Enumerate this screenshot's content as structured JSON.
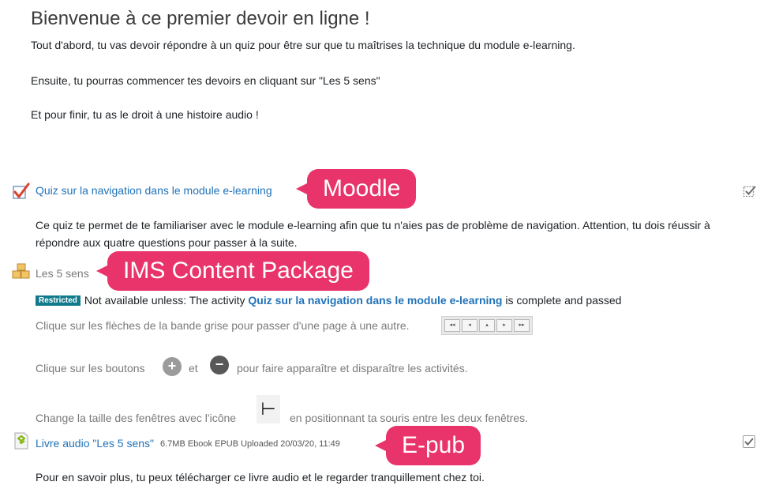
{
  "header": {
    "title": "Bienvenue à ce premier devoir en ligne !"
  },
  "intro": {
    "p1": "Tout d'abord, tu vas devoir répondre à un quiz pour être sur que tu maîtrises la technique du module e-learning.",
    "p2": "Ensuite, tu pourras commencer tes devoirs en cliquant sur \"Les 5 sens\"",
    "p3": "Et pour finir, tu as le droit à une histoire audio !"
  },
  "quiz": {
    "icon": "quiz-checkmark-icon",
    "link": "Quiz sur la navigation dans le module e-learning",
    "description": "Ce quiz te permet de te familiariser avec le module e-learning afin que tu n'aies pas de problème de navigation. Attention, tu dois réussir à répondre aux quatre questions pour passer à la suite.",
    "callout": "Moodle"
  },
  "scorm": {
    "icon": "package-boxes-icon",
    "link": "Les 5 sens",
    "callout": "IMS Content Package",
    "restriction": {
      "badge": "Restricted",
      "prefix": "Not available unless: The activity ",
      "activity": "Quiz sur la navigation dans le module e-learning",
      "suffix": " is complete and passed"
    },
    "hint1": "Clique sur les flèches de la bande grise pour passer d'une page à une autre.",
    "hint2_pre": "Clique sur les boutons",
    "hint2_mid": "et",
    "hint2_post": "pour faire apparaître et disparaître les activités.",
    "hint3_pre": "Change la taille des fenêtres avec l'icône",
    "hint3_post": "en positionnant ta souris entre les deux fenêtres.",
    "nav_glyphs": [
      "◂◂",
      "◂",
      "▴",
      "▸",
      "▸▸"
    ],
    "plus_glyph": "+",
    "minus_glyph": "−",
    "resize_glyph": "⊢"
  },
  "epub": {
    "icon": "epub-book-icon",
    "link": "Livre audio \"Les 5 sens\"",
    "meta": "6.7MB Ebook EPUB Uploaded 20/03/20, 11:49",
    "callout": "E-pub",
    "description": "Pour en savoir plus, tu peux télécharger ce livre audio et le regarder tranquillement chez toi."
  },
  "colors": {
    "link": "#2172b8",
    "callout": "#e8336b",
    "badge": "#117a8b"
  }
}
